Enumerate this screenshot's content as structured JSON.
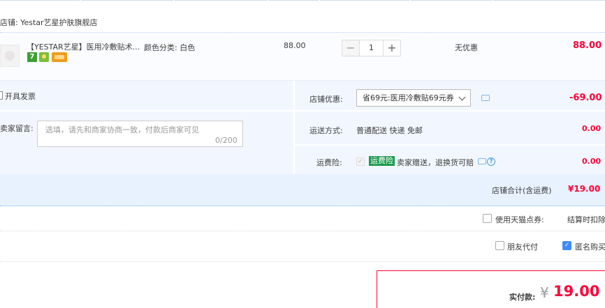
{
  "shop": {
    "label": "店铺: Yestar艺星护肤旗舰店"
  },
  "item": {
    "title": "【YESTAR艺星】医用冷敷贴术...",
    "sku": "颜色分类:  白色",
    "badge_7": "7",
    "price": "88.00",
    "quantity": "1",
    "qty_minus": "−",
    "qty_plus": "+",
    "discount": "无优惠",
    "subtotal": "88.00"
  },
  "invoice": {
    "label": "开具发票"
  },
  "message": {
    "label": "卖家留言:",
    "placeholder": "选填，请先和商家协商一致，付款后商家可见",
    "counter": "0/200"
  },
  "shop_discount": {
    "label": "店铺优惠:",
    "selected": "省69元:医用冷敷贴69元券",
    "amount": "-69.00"
  },
  "shipping": {
    "label": "运送方式:",
    "value": "普通配送 快递 免邮",
    "amount": "0.00"
  },
  "insurance": {
    "label": "运费险:",
    "tag": "运费险",
    "desc": "卖家赠送，退换货可赔",
    "help": "?",
    "amount": "0.00"
  },
  "shop_total": {
    "label": "店铺合计(含运费)",
    "amount": "¥19.00"
  },
  "options": {
    "tmall_points": "使用天猫点券:",
    "settle_note": "结算时扣除",
    "friend_pay": "朋友代付",
    "anonymous": "匿名购买",
    "anonymous_checked": true
  },
  "payment": {
    "label": "实付款:",
    "currency": "¥",
    "amount": "19.00"
  },
  "colors": {
    "accent_red": "#ff0036",
    "panel_blue": "#f2f7ff",
    "check_blue": "#3d8bfd"
  },
  "icons": [
    "chat-icon",
    "help-icon",
    "chevron-down-icon",
    "checkbox-icon"
  ]
}
